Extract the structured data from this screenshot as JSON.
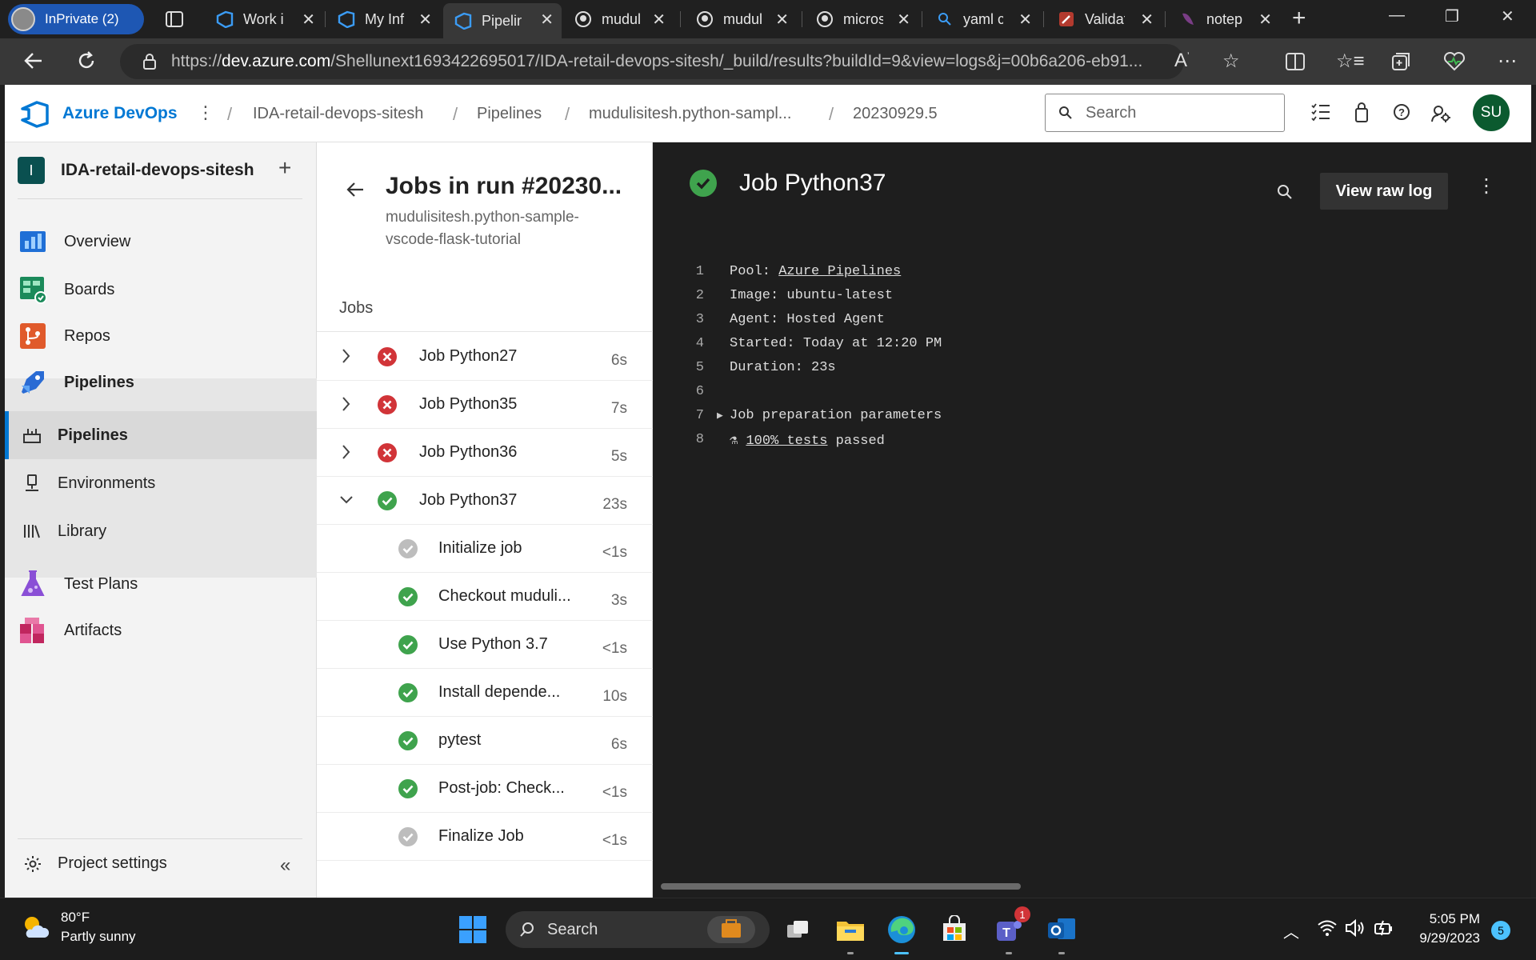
{
  "browser": {
    "profile_label": "InPrivate (2)",
    "tabs": [
      {
        "label": "Work i",
        "icon": "azure-devops-icon",
        "active": false
      },
      {
        "label": "My Inf",
        "icon": "azure-devops-icon",
        "active": false
      },
      {
        "label": "Pipelin",
        "icon": "azure-devops-icon",
        "active": true
      },
      {
        "label": "mudul",
        "icon": "github-icon",
        "active": false
      },
      {
        "label": "mudul",
        "icon": "github-icon",
        "active": false
      },
      {
        "label": "micros",
        "icon": "github-icon",
        "active": false
      },
      {
        "label": "yaml c",
        "icon": "search-icon",
        "active": false
      },
      {
        "label": "Validat",
        "icon": "tool-icon",
        "active": false
      },
      {
        "label": "notep",
        "icon": "notepad-icon",
        "active": false
      }
    ],
    "url_prefix": "https://",
    "url_host": "dev.azure.com",
    "url_rest": "/Shellunext1693422695017/IDA-retail-devops-sitesh/_build/results?buildId=9&view=logs&j=00b6a206-eb91..."
  },
  "header": {
    "app_name": "Azure DevOps",
    "breadcrumbs": [
      "IDA-retail-devops-sitesh",
      "Pipelines",
      "mudulisitesh.python-sampl...",
      "20230929.5"
    ],
    "search_placeholder": "Search",
    "avatar_initials": "SU"
  },
  "sidebar": {
    "project_initial": "I",
    "project_name": "IDA-retail-devops-sitesh",
    "items": [
      {
        "label": "Overview",
        "icon": "overview-icon"
      },
      {
        "label": "Boards",
        "icon": "boards-icon"
      },
      {
        "label": "Repos",
        "icon": "repos-icon"
      },
      {
        "label": "Pipelines",
        "icon": "pipelines-icon"
      },
      {
        "label": "Pipelines",
        "icon": "pipelines-sub-icon"
      },
      {
        "label": "Environments",
        "icon": "environments-icon"
      },
      {
        "label": "Library",
        "icon": "library-icon"
      },
      {
        "label": "Test Plans",
        "icon": "test-plans-icon"
      },
      {
        "label": "Artifacts",
        "icon": "artifacts-icon"
      }
    ],
    "settings_label": "Project settings"
  },
  "jobs_panel": {
    "title": "Jobs in run #20230...",
    "subtitle": "mudulisitesh.python-sample-vscode-flask-tutorial",
    "jobs_label": "Jobs",
    "jobs": [
      {
        "name": "Job Python27",
        "duration": "6s",
        "status": "failed",
        "expanded": false
      },
      {
        "name": "Job Python35",
        "duration": "7s",
        "status": "failed",
        "expanded": false
      },
      {
        "name": "Job Python36",
        "duration": "5s",
        "status": "failed",
        "expanded": false
      },
      {
        "name": "Job Python37",
        "duration": "23s",
        "status": "succeeded",
        "expanded": true
      }
    ],
    "steps": [
      {
        "name": "Initialize job",
        "duration": "<1s",
        "status": "neutral"
      },
      {
        "name": "Checkout muduli...",
        "duration": "3s",
        "status": "succeeded"
      },
      {
        "name": "Use Python 3.7",
        "duration": "<1s",
        "status": "succeeded"
      },
      {
        "name": "Install depende...",
        "duration": "10s",
        "status": "succeeded"
      },
      {
        "name": "pytest",
        "duration": "6s",
        "status": "succeeded"
      },
      {
        "name": "Post-job: Check...",
        "duration": "<1s",
        "status": "succeeded"
      },
      {
        "name": "Finalize Job",
        "duration": "<1s",
        "status": "neutral"
      }
    ]
  },
  "log_panel": {
    "title": "Job Python37",
    "raw_log_label": "View raw log",
    "lines": [
      {
        "num": "1",
        "prefix": "Pool: ",
        "link": "Azure Pipelines",
        "suffix": ""
      },
      {
        "num": "2",
        "prefix": "Image: ubuntu-latest",
        "link": "",
        "suffix": ""
      },
      {
        "num": "3",
        "prefix": "Agent: Hosted Agent",
        "link": "",
        "suffix": ""
      },
      {
        "num": "4",
        "prefix": "Started: Today at 12:20 PM",
        "link": "",
        "suffix": ""
      },
      {
        "num": "5",
        "prefix": "Duration: 23s",
        "link": "",
        "suffix": ""
      },
      {
        "num": "6",
        "prefix": "",
        "link": "",
        "suffix": ""
      },
      {
        "num": "7",
        "prefix": "Job preparation parameters",
        "link": "",
        "suffix": ""
      },
      {
        "num": "8",
        "prefix": "",
        "link": "100% tests",
        "suffix": " passed"
      }
    ]
  },
  "taskbar": {
    "weather_temp": "80°F",
    "weather_desc": "Partly sunny",
    "search_label": "Search",
    "time": "5:05 PM",
    "date": "9/29/2023",
    "notification_count": "5",
    "teams_badge": "1"
  },
  "colors": {
    "accent": "#0078d4",
    "success": "#3fa34d",
    "failure": "#d13438",
    "log_bg": "#1e1e1e"
  }
}
